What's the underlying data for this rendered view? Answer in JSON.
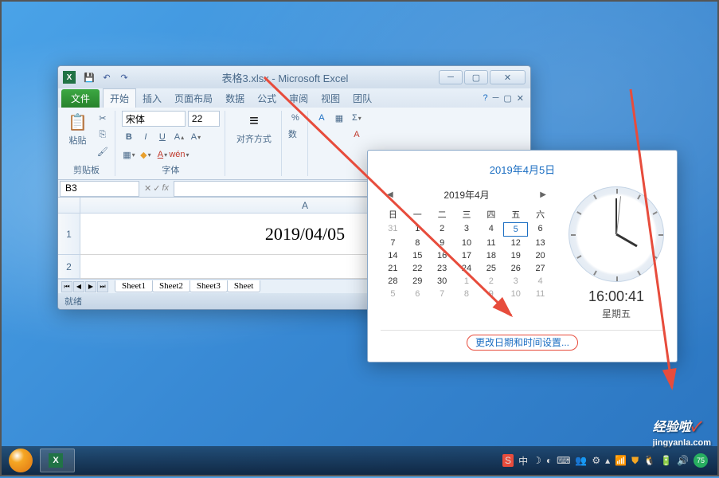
{
  "excel": {
    "title": "表格3.xlsx - Microsoft Excel",
    "file_tab": "文件",
    "tabs": [
      "开始",
      "插入",
      "页面布局",
      "数据",
      "公式",
      "审阅",
      "视图",
      "团队"
    ],
    "clipboard": {
      "paste_label": "粘贴",
      "group_label": "剪贴板"
    },
    "font": {
      "name": "宋体",
      "size": "22",
      "group_label": "字体"
    },
    "alignment_label": "对齐方式",
    "number_label": "数",
    "name_box": "B3",
    "cell_a1": "2019/04/05",
    "col_a": "A",
    "row1": "1",
    "row2": "2",
    "sheets": [
      "Sheet1",
      "Sheet2",
      "Sheet3",
      "Sheet"
    ],
    "status": "就绪"
  },
  "clock": {
    "date_title": "2019年4月5日",
    "month": "2019年4月",
    "dows": [
      "日",
      "一",
      "二",
      "三",
      "四",
      "五",
      "六"
    ],
    "days_prev": [
      "31"
    ],
    "days_curr": [
      "1",
      "2",
      "3",
      "4",
      "5",
      "6",
      "7",
      "8",
      "9",
      "10",
      "11",
      "12",
      "13",
      "14",
      "15",
      "16",
      "17",
      "18",
      "19",
      "20",
      "21",
      "22",
      "23",
      "24",
      "25",
      "26",
      "27",
      "28",
      "29",
      "30"
    ],
    "days_next": [
      "1",
      "2",
      "3",
      "4",
      "5",
      "6",
      "7",
      "8",
      "9",
      "10",
      "11"
    ],
    "today": "5",
    "time": "16:00:41",
    "weekday": "星期五",
    "link": "更改日期和时间设置..."
  },
  "taskbar": {
    "ime": "中"
  },
  "watermark": {
    "text": "经验啦",
    "sub": "jingyanla.com"
  }
}
